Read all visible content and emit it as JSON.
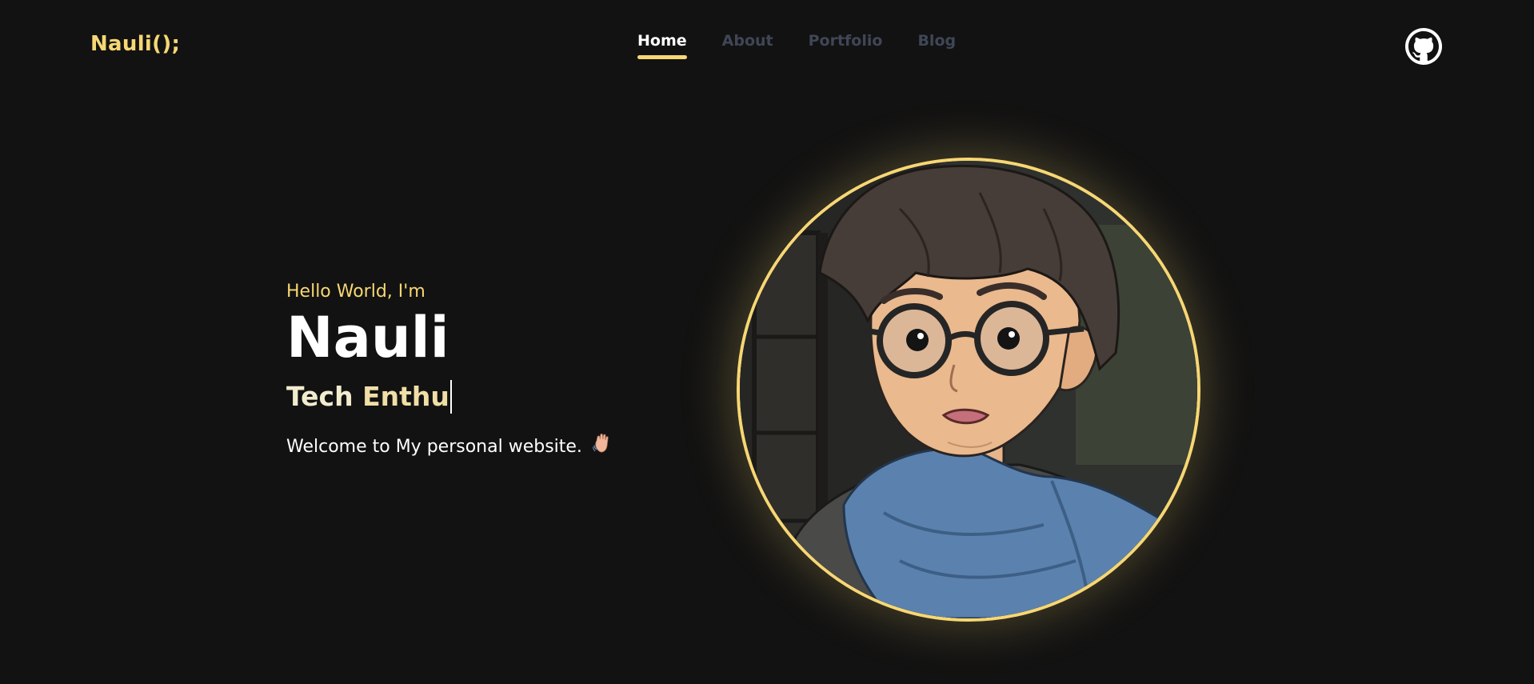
{
  "header": {
    "logo": "Nauli();",
    "nav": [
      {
        "label": "Home",
        "active": true
      },
      {
        "label": "About",
        "active": false
      },
      {
        "label": "Portfolio",
        "active": false
      },
      {
        "label": "Blog",
        "active": false
      }
    ],
    "github_icon": "github-icon"
  },
  "hero": {
    "greeting": "Hello World, I'm",
    "name": "Nauli",
    "role_prefix": "Tech",
    "role_typed": "Enthu",
    "welcome": "Welcome to My personal website.",
    "wave_icon": "waving-hand-icon"
  },
  "colors": {
    "background": "#121212",
    "accent": "#f7d774",
    "inactive_nav": "#3f4656",
    "text": "#ffffff"
  }
}
